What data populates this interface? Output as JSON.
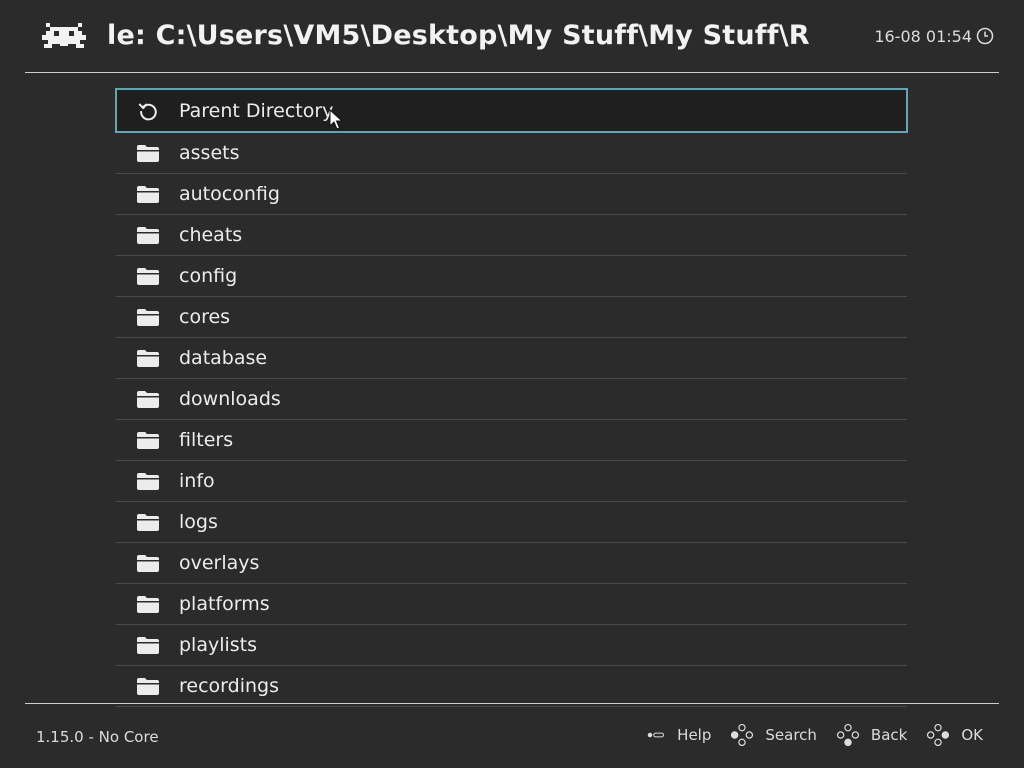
{
  "header": {
    "title": "le: C:\\Users\\VM5\\Desktop\\My Stuff\\My Stuff\\R",
    "clock": "16-08 01:54",
    "logo_icon": "space-invader-icon",
    "clock_icon": "clock-icon"
  },
  "list": {
    "selected_index": 0,
    "items": [
      {
        "label": "Parent Directory",
        "icon": "refresh-icon"
      },
      {
        "label": "assets",
        "icon": "folder-icon"
      },
      {
        "label": "autoconfig",
        "icon": "folder-icon"
      },
      {
        "label": "cheats",
        "icon": "folder-icon"
      },
      {
        "label": "config",
        "icon": "folder-icon"
      },
      {
        "label": "cores",
        "icon": "folder-icon"
      },
      {
        "label": "database",
        "icon": "folder-icon"
      },
      {
        "label": "downloads",
        "icon": "folder-icon"
      },
      {
        "label": "filters",
        "icon": "folder-icon"
      },
      {
        "label": "info",
        "icon": "folder-icon"
      },
      {
        "label": "logs",
        "icon": "folder-icon"
      },
      {
        "label": "overlays",
        "icon": "folder-icon"
      },
      {
        "label": "platforms",
        "icon": "folder-icon"
      },
      {
        "label": "playlists",
        "icon": "folder-icon"
      },
      {
        "label": "recordings",
        "icon": "folder-icon"
      }
    ]
  },
  "footer": {
    "version": "1.15.0 - No Core",
    "hints": [
      {
        "label": "Help",
        "icon": "select-button-icon"
      },
      {
        "label": "Search",
        "icon": "gamepad-buttons-icon"
      },
      {
        "label": "Back",
        "icon": "gamepad-buttons-icon"
      },
      {
        "label": "OK",
        "icon": "gamepad-buttons-icon"
      }
    ]
  },
  "colors": {
    "background": "#2b2b2b",
    "selection_border": "#68a3b4",
    "selection_fill": "#1f1f1f",
    "divider": "#4a4a4a",
    "text": "#ececec"
  }
}
